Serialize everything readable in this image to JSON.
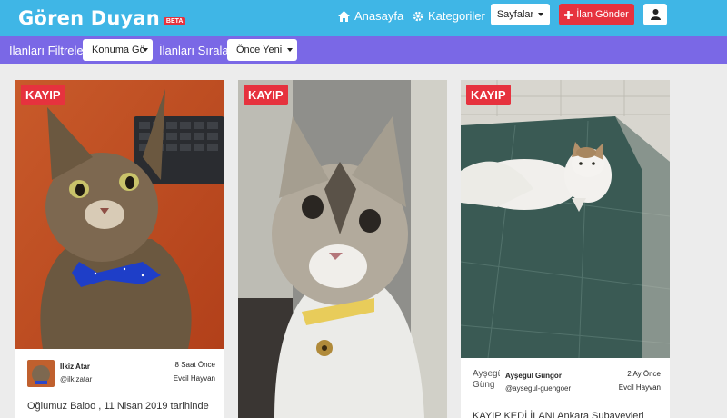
{
  "header": {
    "brand": "Gören Duyan",
    "beta": "BETA",
    "nav": {
      "home": "Anasayfa",
      "categories": "Kategoriler"
    },
    "pages_button": "Sayfalar",
    "post_button": "İlan Gönder"
  },
  "filters": {
    "filter_label": "İlanları Filtrele:",
    "location_select": "Konuma Gö",
    "sort_label": "İlanları Sırala:",
    "sort_select": "Önce Yeni"
  },
  "colors": {
    "navbar": "#3fb6e6",
    "filterbar": "#7a68e6",
    "badge": "#e6323e"
  },
  "cards": [
    {
      "badge": "KAYIP",
      "author_name": "İlkiz Atar",
      "author_handle": "@ilkizatar",
      "time": "8 Saat Önce",
      "category": "Evcil Hayvan",
      "description": "Oğlumuz Baloo , 11 Nisan 2019 tarihinde"
    },
    {
      "badge": "KAYIP"
    },
    {
      "badge": "KAYIP",
      "avatar_alt": "Ayşegül Güng",
      "author_name": "Ayşegül Güngör",
      "author_handle": "@aysegul-guengoer",
      "time": "2 Ay Önce",
      "category": "Evcil Hayvan",
      "description": "KAYIP KEDİ İLANI Ankara Subayevleri"
    }
  ]
}
